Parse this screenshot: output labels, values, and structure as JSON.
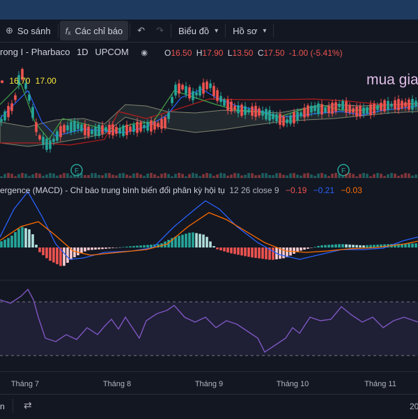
{
  "toolbar": {
    "compare_label": "So sánh",
    "indicators_label": "Các chỉ báo",
    "chart_label": "Biểu đồ",
    "profile_label": "Hồ sơ"
  },
  "symbol": {
    "name": "rong I - Pharbaco",
    "interval": "1D",
    "exchange": "UPCOM",
    "o_label": "O",
    "o_value": "16.50",
    "h_label": "H",
    "h_value": "17.90",
    "l_label": "L",
    "l_value": "13.50",
    "c_label": "C",
    "c_value": "17.50",
    "change": "-1.00 (-5.41%)",
    "price_low": "16.70",
    "price_high": "17.00"
  },
  "annotation": "mua gia",
  "macd": {
    "label": "ergence (MACD) - Chỉ báo trung bình biến đổi phân kỳ hội tụ",
    "params": "12 26 close 9",
    "hist": "−0.19",
    "macd": "−0.21",
    "signal": "−0.03"
  },
  "x_axis": [
    "Tháng 7",
    "Tháng 8",
    "Tháng 9",
    "Tháng 10",
    "Tháng 11"
  ],
  "markers": [
    "F",
    "F"
  ],
  "bottom": {
    "left_text": "n",
    "right_text": "20"
  },
  "colors": {
    "up": "#26a69a",
    "down": "#ef5350",
    "macd_line": "#2962ff",
    "signal_line": "#ff6d00",
    "rsi_line": "#7e57c2",
    "annotation": "#e1bee7"
  }
}
